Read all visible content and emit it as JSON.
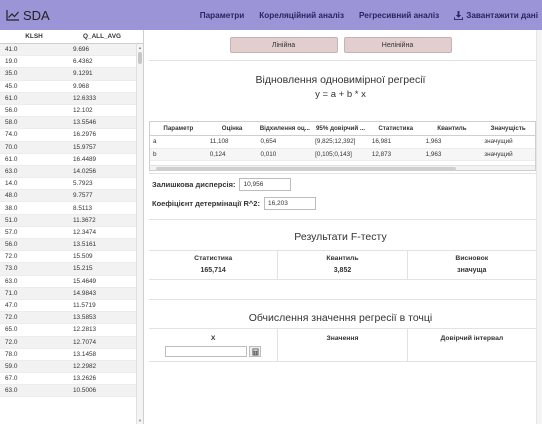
{
  "app": {
    "title": "SDA"
  },
  "nav": {
    "items": [
      {
        "label": "Параметри"
      },
      {
        "label": "Кореляційний аналіз"
      },
      {
        "label": "Регресивний аналіз"
      },
      {
        "label": "Завантажити дані"
      }
    ]
  },
  "data_table": {
    "headers": [
      "KLSH",
      "Q_ALL_AVG"
    ],
    "rows": [
      [
        "41.0",
        "9.696"
      ],
      [
        "19.0",
        "6.4362"
      ],
      [
        "35.0",
        "9.1291"
      ],
      [
        "45.0",
        "9.968"
      ],
      [
        "61.0",
        "12.6333"
      ],
      [
        "56.0",
        "12.102"
      ],
      [
        "58.0",
        "13.5546"
      ],
      [
        "74.0",
        "16.2976"
      ],
      [
        "70.0",
        "15.9757"
      ],
      [
        "61.0",
        "16.4489"
      ],
      [
        "63.0",
        "14.0256"
      ],
      [
        "14.0",
        "5.7923"
      ],
      [
        "48.0",
        "9.7577"
      ],
      [
        "38.0",
        "8.5113"
      ],
      [
        "51.0",
        "11.3672"
      ],
      [
        "57.0",
        "12.3474"
      ],
      [
        "56.0",
        "13.5161"
      ],
      [
        "72.0",
        "15.509"
      ],
      [
        "73.0",
        "15.215"
      ],
      [
        "63.0",
        "15.4649"
      ],
      [
        "71.0",
        "14.9843"
      ],
      [
        "47.0",
        "11.5719"
      ],
      [
        "72.0",
        "13.5853"
      ],
      [
        "65.0",
        "12.2813"
      ],
      [
        "72.0",
        "12.7074"
      ],
      [
        "78.0",
        "13.1458"
      ],
      [
        "59.0",
        "12.2982"
      ],
      [
        "67.0",
        "13.2626"
      ],
      [
        "63.0",
        "10.5006"
      ]
    ]
  },
  "buttons": {
    "linear": "Лінійна",
    "nonlinear": "Нелінійна"
  },
  "regression": {
    "title": "Відновлення одновимірної регресії",
    "formula": "y = a + b * x",
    "headers": [
      "Параметр",
      "Оцінка",
      "Відхилення оц...",
      "95% довірчий ...",
      "Статистика",
      "Квантиль",
      "Значущість"
    ],
    "rows": [
      [
        "a",
        "11,108",
        "0,654",
        "[9,825;12,392]",
        "16,981",
        "1,963",
        "значущий"
      ],
      [
        "b",
        "0,124",
        "0,010",
        "[0,105;0,143]",
        "12,873",
        "1,963",
        "значущий"
      ]
    ]
  },
  "residual": {
    "label": "Залишкова дисперсія:",
    "value": "10,956"
  },
  "determination": {
    "label": "Коефіцієнт детермінації R^2:",
    "value": "16,203"
  },
  "ftest": {
    "title": "Результати F-тесту",
    "columns": [
      {
        "header": "Статистика",
        "value": "165,714"
      },
      {
        "header": "Квантиль",
        "value": "3,852"
      },
      {
        "header": "Висновок",
        "value": "значуща"
      }
    ]
  },
  "point": {
    "title": "Обчислення значення регресії в точці",
    "columns": [
      {
        "header": "X"
      },
      {
        "header": "Значення"
      },
      {
        "header": "Довірчий інтервал"
      }
    ]
  },
  "colors": {
    "navbar": "#9b94d6",
    "nav_text": "#2a2460",
    "button": "#e2cece"
  },
  "icons": {
    "brand": "chart-line-icon",
    "download": "download-icon",
    "calculator": "calculator-icon"
  }
}
